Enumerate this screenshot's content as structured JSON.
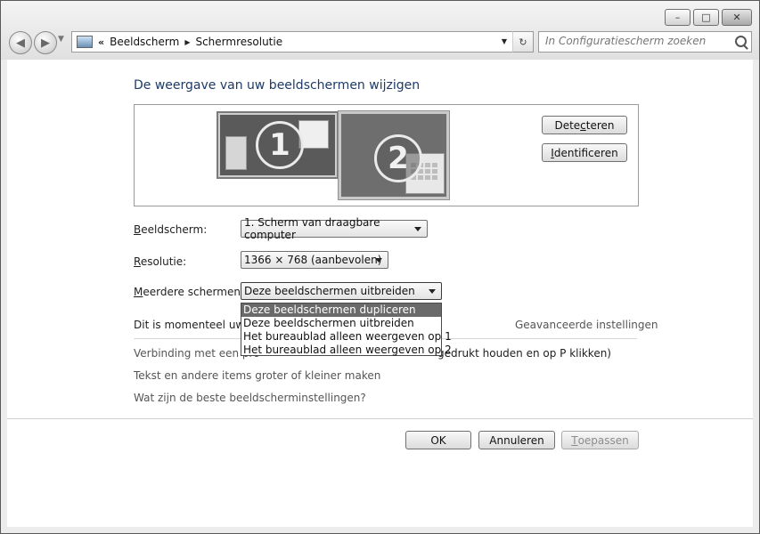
{
  "window": {
    "minimize_glyph": "–",
    "maximize_glyph": "□",
    "close_glyph": "✕"
  },
  "nav": {
    "back_glyph": "◀",
    "forward_glyph": "▶",
    "recent_glyph": "▼"
  },
  "address": {
    "overflow": "«",
    "sep": "▶",
    "crumbs": [
      "Beeldscherm",
      "Schermresolutie"
    ],
    "drop_glyph": "▼",
    "refresh_glyph": "↻"
  },
  "search": {
    "placeholder": "In Configuratiescherm zoeken"
  },
  "main": {
    "heading": "De weergave van uw beeldschermen wijzigen",
    "monitor1": "1",
    "monitor2": "2",
    "detect": {
      "pre": "Dete",
      "key": "c",
      "post": "teren"
    },
    "identify": {
      "pre": "",
      "key": "I",
      "post": "dentificeren"
    }
  },
  "settings": {
    "display_label": {
      "key": "B",
      "rest": "eeldscherm:"
    },
    "display_value": "1. Scherm van draagbare computer",
    "resolution_label": {
      "key": "R",
      "rest": "esolutie:"
    },
    "resolution_value": "1366 × 768 (aanbevolen)",
    "multiple_label": {
      "key": "M",
      "rest": "eerdere schermen:"
    },
    "multiple_value": "Deze beeldschermen uitbreiden",
    "multiple_options": [
      "Deze beeldschermen dupliceren",
      "Deze beeldschermen uitbreiden",
      "Het bureaublad alleen weergeven op 1",
      "Het bureaublad alleen weergeven op 2"
    ]
  },
  "info": {
    "current_text": "Dit is momenteel uw h",
    "advanced_link": "Geavanceerde instellingen"
  },
  "links": {
    "projector_left": "Verbinding met een pro",
    "projector_right": "gedrukt houden en op P klikken)",
    "text_size": "Tekst en andere items groter of kleiner maken",
    "best_settings": "Wat zijn de beste beeldscherminstellingen?"
  },
  "footer": {
    "ok": "OK",
    "cancel": "Annuleren",
    "apply": {
      "key": "T",
      "rest": "oepassen"
    }
  }
}
